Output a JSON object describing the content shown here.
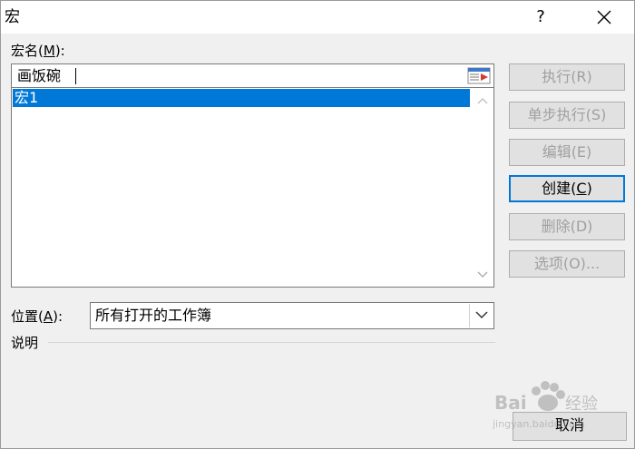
{
  "window": {
    "title": "宏",
    "help_label": "?",
    "close_icon": "close-icon"
  },
  "macro_name": {
    "label_prefix": "宏名(",
    "label_hotkey": "M",
    "label_suffix": "):",
    "value": "画饭碗",
    "refedit_icon": "collapse-dialog-icon"
  },
  "macro_list": {
    "items": [
      "宏1"
    ],
    "selected_index": 0
  },
  "buttons": {
    "run": "执行(R)",
    "step_into": "单步执行(S)",
    "edit": "编辑(E)",
    "create_prefix": "创建(",
    "create_hotkey": "C",
    "create_suffix": ")",
    "delete": "删除(D)",
    "options": "选项(O)...",
    "cancel": "取消"
  },
  "location": {
    "label_prefix": "位置(",
    "label_hotkey": "A",
    "label_suffix": "):",
    "value": "所有打开的工作簿"
  },
  "description": {
    "label": "说明"
  },
  "watermark": {
    "brand": "Bai",
    "brand_cn": "经验",
    "url": "jingyan.baidu.com"
  },
  "colors": {
    "selection": "#0078d7",
    "dialog_bg": "#f0f0f0",
    "disabled_text": "#a0a0a0"
  }
}
